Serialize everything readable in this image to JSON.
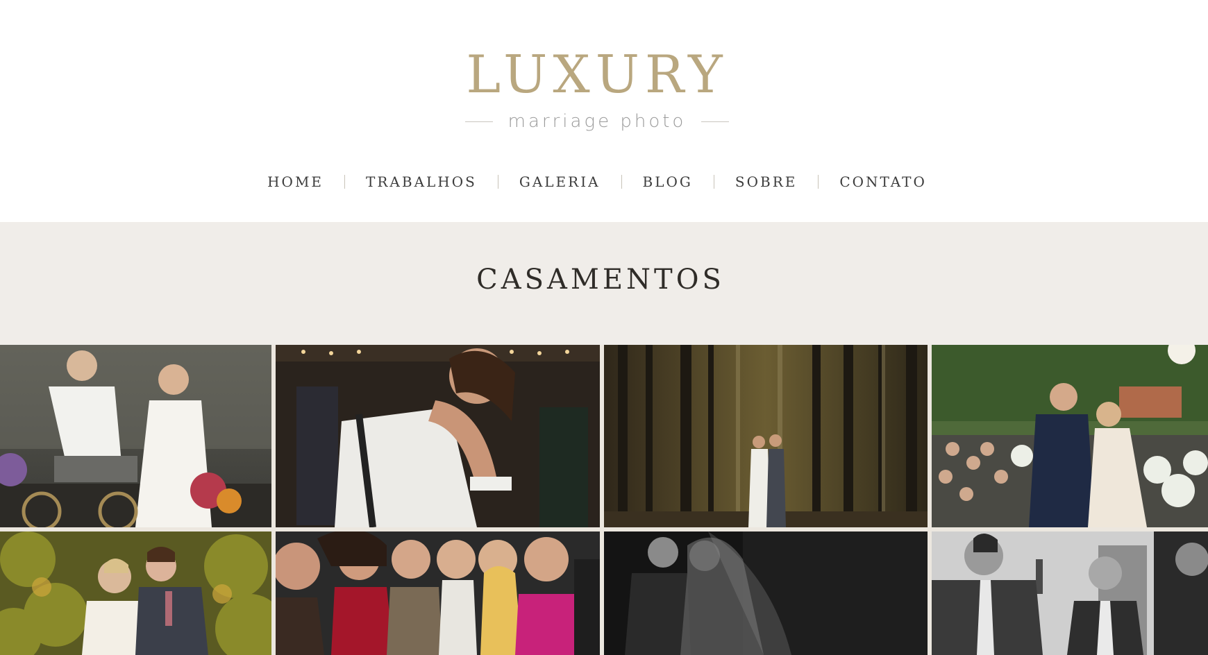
{
  "brand": {
    "title": "LUXURY",
    "subtitle": "marriage photo",
    "color": "#b9a77f"
  },
  "nav": {
    "items": [
      {
        "label": "HOME"
      },
      {
        "label": "TRABALHOS"
      },
      {
        "label": "GALERIA"
      },
      {
        "label": "BLOG"
      },
      {
        "label": "SOBRE"
      },
      {
        "label": "CONTATO"
      }
    ]
  },
  "section": {
    "title": "CASAMENTOS",
    "background": "#f0ede9"
  },
  "gallery": {
    "photos": [
      {
        "name": "couple-bicycle-photo"
      },
      {
        "name": "bride-hug-photo"
      },
      {
        "name": "forest-couple-photo"
      },
      {
        "name": "ceremony-kiss-photo"
      },
      {
        "name": "garden-couple-photo"
      },
      {
        "name": "guests-celebration-photo"
      },
      {
        "name": "bw-veil-couple-photo"
      },
      {
        "name": "bw-groomsmen-photo"
      }
    ]
  }
}
